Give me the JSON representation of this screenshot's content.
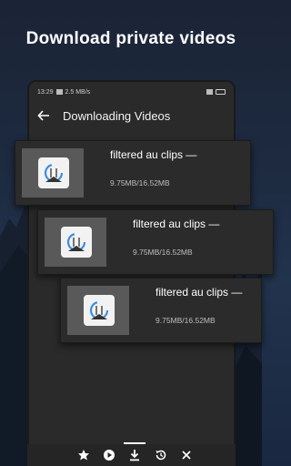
{
  "headline": "Download private videos",
  "status_bar": {
    "time": "13:29",
    "network_speed": "2.5 MB/s"
  },
  "app_bar": {
    "title": "Downloading Videos",
    "back_icon": "arrow-left-icon"
  },
  "downloads": [
    {
      "title": "filtered au clips —",
      "size": "9.75MB/16.52MB",
      "thumbnail_icon": "download-progress-icon"
    },
    {
      "title": "filtered au clips —",
      "size": "9.75MB/16.52MB",
      "thumbnail_icon": "download-progress-icon"
    },
    {
      "title": "filtered au clips —",
      "size": "9.75MB/16.52MB",
      "thumbnail_icon": "download-progress-icon"
    }
  ],
  "bottom_nav": [
    {
      "icon": "star-icon",
      "active": false
    },
    {
      "icon": "play-circle-icon",
      "active": false
    },
    {
      "icon": "download-icon",
      "active": true
    },
    {
      "icon": "history-icon",
      "active": false
    },
    {
      "icon": "close-icon",
      "active": false
    }
  ],
  "colors": {
    "background": "#1d2a40",
    "card": "#2b2b2b",
    "accent_blue": "#3d8ee0"
  }
}
